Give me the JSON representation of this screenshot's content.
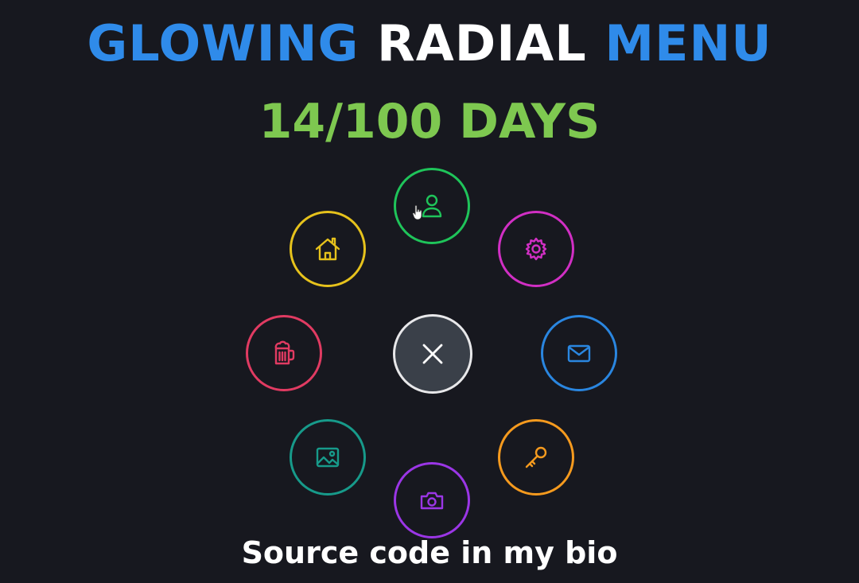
{
  "title": {
    "word1": "GLOWING",
    "word2": "RADIAL",
    "word3": "MENU",
    "color_accent": "#2f8bea",
    "color_main": "#ffffff"
  },
  "subtitle": {
    "text": "14/100 DAYS",
    "color": "#7ec850"
  },
  "caption": {
    "text": "Source code in my bio",
    "color": "#ffffff"
  },
  "menu": {
    "center": {
      "icon": "close-icon",
      "color": "#e8e8ea"
    },
    "items": [
      {
        "name": "user",
        "icon": "user-icon",
        "color": "#1fc45a"
      },
      {
        "name": "settings",
        "icon": "gear-icon",
        "color": "#d12fc4"
      },
      {
        "name": "mail",
        "icon": "mail-icon",
        "color": "#2a86e0"
      },
      {
        "name": "key",
        "icon": "key-icon",
        "color": "#f59a1e"
      },
      {
        "name": "camera",
        "icon": "camera-icon",
        "color": "#9b36e6"
      },
      {
        "name": "image",
        "icon": "image-icon",
        "color": "#179a8a"
      },
      {
        "name": "beer",
        "icon": "beer-icon",
        "color": "#e13b62"
      },
      {
        "name": "home",
        "icon": "home-icon",
        "color": "#e6c21c"
      }
    ]
  }
}
